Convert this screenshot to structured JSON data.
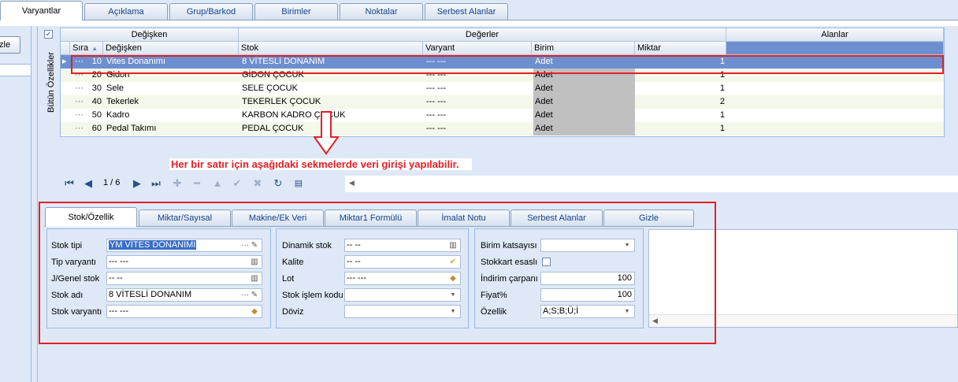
{
  "top_tabs": [
    "Varyantlar",
    "Açıklama",
    "Grup/Barkod",
    "Birimler",
    "Noktalar",
    "Serbest Alanlar"
  ],
  "left_button_label": "zle",
  "vertical_title": "Bütün Özellikler",
  "grid": {
    "band_headers": {
      "degisken": "Değişken",
      "degerler": "Değerler",
      "alanlar": "Alanlar"
    },
    "columns": {
      "sira": "Sıra",
      "degisken": "Değişken",
      "stok": "Stok",
      "varyant": "Varyant",
      "birim": "Birim",
      "miktar": "Miktar"
    },
    "rows": [
      {
        "sira": "10",
        "degisken": "Vites Donanımı",
        "stok": "8 VİTESLİ DONANIM",
        "varyant": "--- ---",
        "birim": "Adet",
        "miktar": "1"
      },
      {
        "sira": "20",
        "degisken": "Gidon",
        "stok": "GİDON ÇOCUK",
        "varyant": "--- ---",
        "birim": "Adet",
        "miktar": "1"
      },
      {
        "sira": "30",
        "degisken": "Sele",
        "stok": "SELE ÇOCUK",
        "varyant": "--- ---",
        "birim": "Adet",
        "miktar": "1"
      },
      {
        "sira": "40",
        "degisken": "Tekerlek",
        "stok": "TEKERLEK ÇOCUK",
        "varyant": "--- ---",
        "birim": "Adet",
        "miktar": "2"
      },
      {
        "sira": "50",
        "degisken": "Kadro",
        "stok": "KARBON KADRO ÇOCUK",
        "varyant": "--- ---",
        "birim": "Adet",
        "miktar": "1"
      },
      {
        "sira": "60",
        "degisken": "Pedal Takımı",
        "stok": "PEDAL ÇOCUK",
        "varyant": "--- ---",
        "birim": "Adet",
        "miktar": "1"
      }
    ]
  },
  "navigator": {
    "record_counter": "1 / 6"
  },
  "annotation": "Her bir satır için aşağıdaki sekmelerde veri girişi yapılabilir.",
  "bottom_tabs": [
    "Stok/Özellik",
    "Miktar/Sayısal",
    "Makine/Ek Veri",
    "Miktar1 Formülü",
    "İmalat Notu",
    "Serbest Alanlar",
    "Gizle"
  ],
  "form": {
    "g1": {
      "stok_tipi_label": "Stok tipi",
      "stok_tipi_value": "YM VİTES DONANIMI",
      "tip_varyanti_label": "Tip varyantı",
      "tip_varyanti_value": "--- ---",
      "genel_stok_label": "J/Genel stok",
      "genel_stok_value": "-- --",
      "stok_adi_label": "Stok adı",
      "stok_adi_value": "8 VİTESLİ DONANIM",
      "stok_varyanti_label": "Stok varyantı",
      "stok_varyanti_value": "--- ---"
    },
    "g2": {
      "dinamik_stok_label": "Dinamik stok",
      "dinamik_stok_value": "-- --",
      "kalite_label": "Kalite",
      "kalite_value": "-- --",
      "lot_label": "Lot",
      "lot_value": "--- ---",
      "stok_islem_kodu_label": "Stok işlem kodu",
      "stok_islem_kodu_value": "",
      "doviz_label": "Döviz",
      "doviz_value": ""
    },
    "g3": {
      "birim_katsayisi_label": "Birim katsayısı",
      "birim_katsayisi_value": "",
      "stokkart_esasli_label": "Stokkart esaslı",
      "indirim_carpani_label": "İndirim çarpanı",
      "indirim_carpani_value": "100",
      "fiyat_label": "Fiyat%",
      "fiyat_value": "100",
      "ozellik_label": "Özellik",
      "ozellik_value": "A;S;B;Ü;İ"
    }
  },
  "colors": {
    "selected_row": "#6d8fd0",
    "annotation_red": "#e32027",
    "alt_row": "#f3f8ea"
  }
}
